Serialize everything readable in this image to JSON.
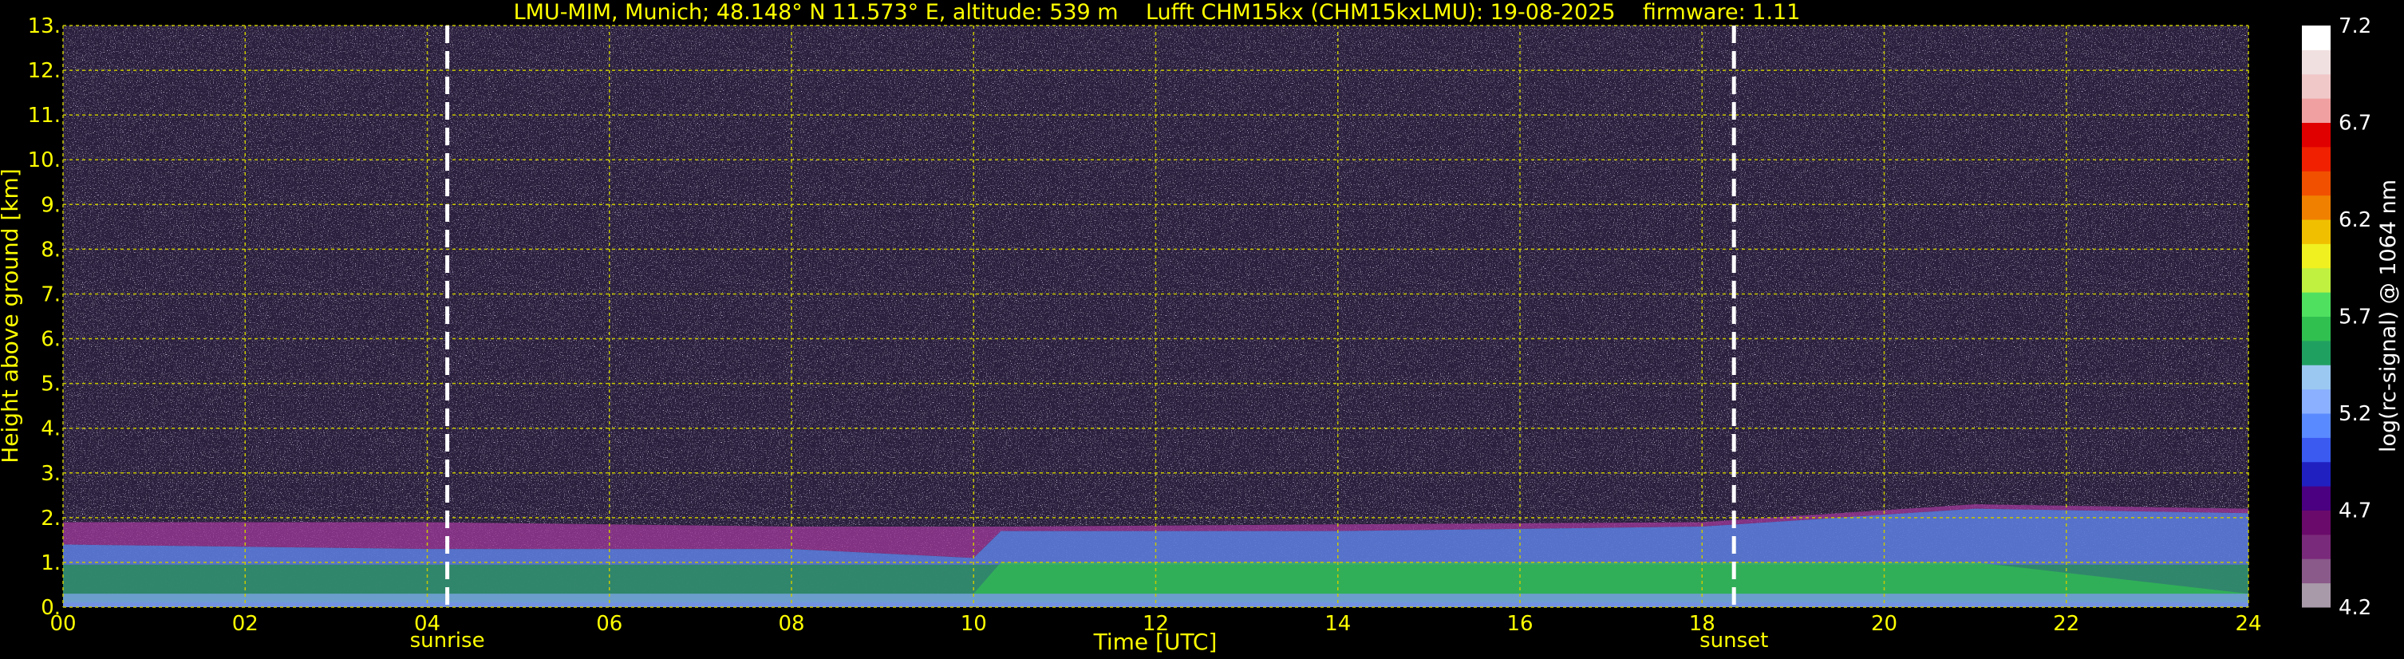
{
  "chart_data": {
    "type": "heatmap",
    "title": "LMU-MIM, Munich; 48.148° N 11.573° E, altitude: 539 m    Lufft CHM15kx (CHM15kxLMU): 19-08-2025    firmware: 1.11",
    "xlabel": "Time [UTC]",
    "ylabel": "Height above ground [km]",
    "xlim": [
      0,
      24
    ],
    "ylim": [
      0,
      13
    ],
    "x_ticks": [
      "00",
      "02",
      "04",
      "06",
      "08",
      "10",
      "12",
      "14",
      "16",
      "18",
      "20",
      "22",
      "24"
    ],
    "y_ticks": [
      "0.",
      "1.",
      "2.",
      "3.",
      "4.",
      "5.",
      "6.",
      "7.",
      "8.",
      "9.",
      "10.",
      "11.",
      "12.",
      "13."
    ],
    "grid": true,
    "markers": [
      {
        "label": "sunrise",
        "time_utc": 4.22
      },
      {
        "label": "sunset",
        "time_utc": 18.35
      }
    ],
    "colorbar": {
      "label": "log(rc-signal) @ 1064 nm",
      "range": [
        4.2,
        7.2
      ],
      "ticks": [
        "7.2",
        "6.7",
        "6.2",
        "5.7",
        "5.2",
        "4.7",
        "4.2"
      ],
      "colors": [
        "#a89aa8",
        "#8a5a8a",
        "#7a2a7a",
        "#6a0a6a",
        "#4a0080",
        "#2020c0",
        "#3a5af0",
        "#5a8aff",
        "#8ab0ff",
        "#9ac8f0",
        "#20a060",
        "#30c050",
        "#50e060",
        "#c0f040",
        "#f0f020",
        "#f0c000",
        "#f08000",
        "#f05000",
        "#f02000",
        "#e00000",
        "#f0a0a0",
        "#f0c8c8",
        "#f0e0e0",
        "#ffffff"
      ]
    },
    "boundary_layer": [
      {
        "t": 0,
        "aerosol_top_km": 1.4,
        "residual_top_km": 1.9
      },
      {
        "t": 4,
        "aerosol_top_km": 1.3,
        "residual_top_km": 1.9
      },
      {
        "t": 8,
        "aerosol_top_km": 1.3,
        "residual_top_km": 1.8
      },
      {
        "t": 10,
        "aerosol_top_km": 1.1,
        "residual_top_km": 1.8
      },
      {
        "t": 10.3,
        "aerosol_top_km": 1.7,
        "residual_top_km": 1.8
      },
      {
        "t": 14,
        "aerosol_top_km": 1.7,
        "residual_top_km": 1.85
      },
      {
        "t": 18,
        "aerosol_top_km": 1.8,
        "residual_top_km": 1.9
      },
      {
        "t": 21,
        "aerosol_top_km": 2.2,
        "residual_top_km": 2.3
      },
      {
        "t": 24,
        "aerosol_top_km": 2.1,
        "residual_top_km": 2.2
      }
    ]
  }
}
